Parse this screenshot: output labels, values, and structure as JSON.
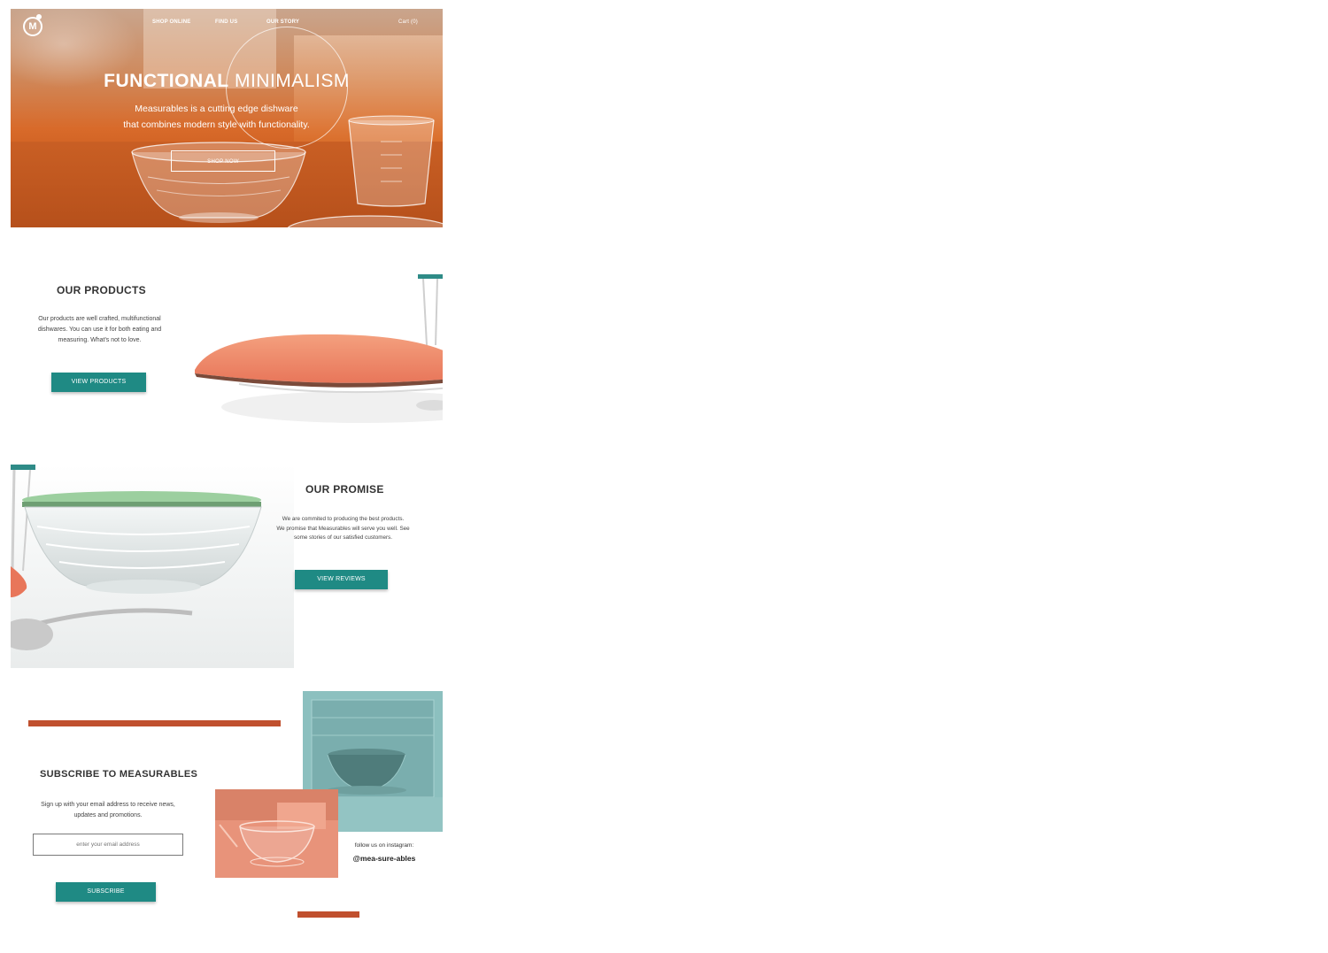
{
  "nav": {
    "logo_letter": "M",
    "items": [
      "SHOP ONLINE",
      "FIND US",
      "OUR STORY"
    ],
    "cart": "Cart (0)"
  },
  "hero": {
    "title_bold": "FUNCTIONAL",
    "title_light": "MINIMALISM",
    "subtitle_line1": "Measurables is a cutting edge dishware",
    "subtitle_line2": "that combines  modern style with functionality.",
    "cta": "SHOP NOW"
  },
  "products": {
    "title": "OUR PRODUCTS",
    "text_line1": "Our products are well crafted, multifunctional",
    "text_line2": "dishwares. You can use it for both eating and",
    "text_line3": "measuring. What's not to love.",
    "cta": "VIEW PRODUCTS"
  },
  "promise": {
    "title": "OUR PROMISE",
    "text_line1": "We are commited to producing the best products.",
    "text_line2": "We promise that Measurables will serve you well. See",
    "text_line3": "some stories of our satisfied customers.",
    "cta": "VIEW REVIEWS"
  },
  "subscribe": {
    "title": "SUBSCRIBE TO MEASURABLES",
    "text_line1": "Sign up with your email address to receive news,",
    "text_line2": "updates and promotions.",
    "email_placeholder": "enter your email address",
    "cta": "SUBSCRIBE"
  },
  "instagram": {
    "label": "follow us on instagram:",
    "handle": "@mea-sure-ables"
  },
  "colors": {
    "teal": "#1f8a84",
    "rust": "#c0502e",
    "hero_orange": "#d86a2a",
    "photo_teal": "#8fc1c0",
    "photo_coral": "#e89a7f"
  }
}
